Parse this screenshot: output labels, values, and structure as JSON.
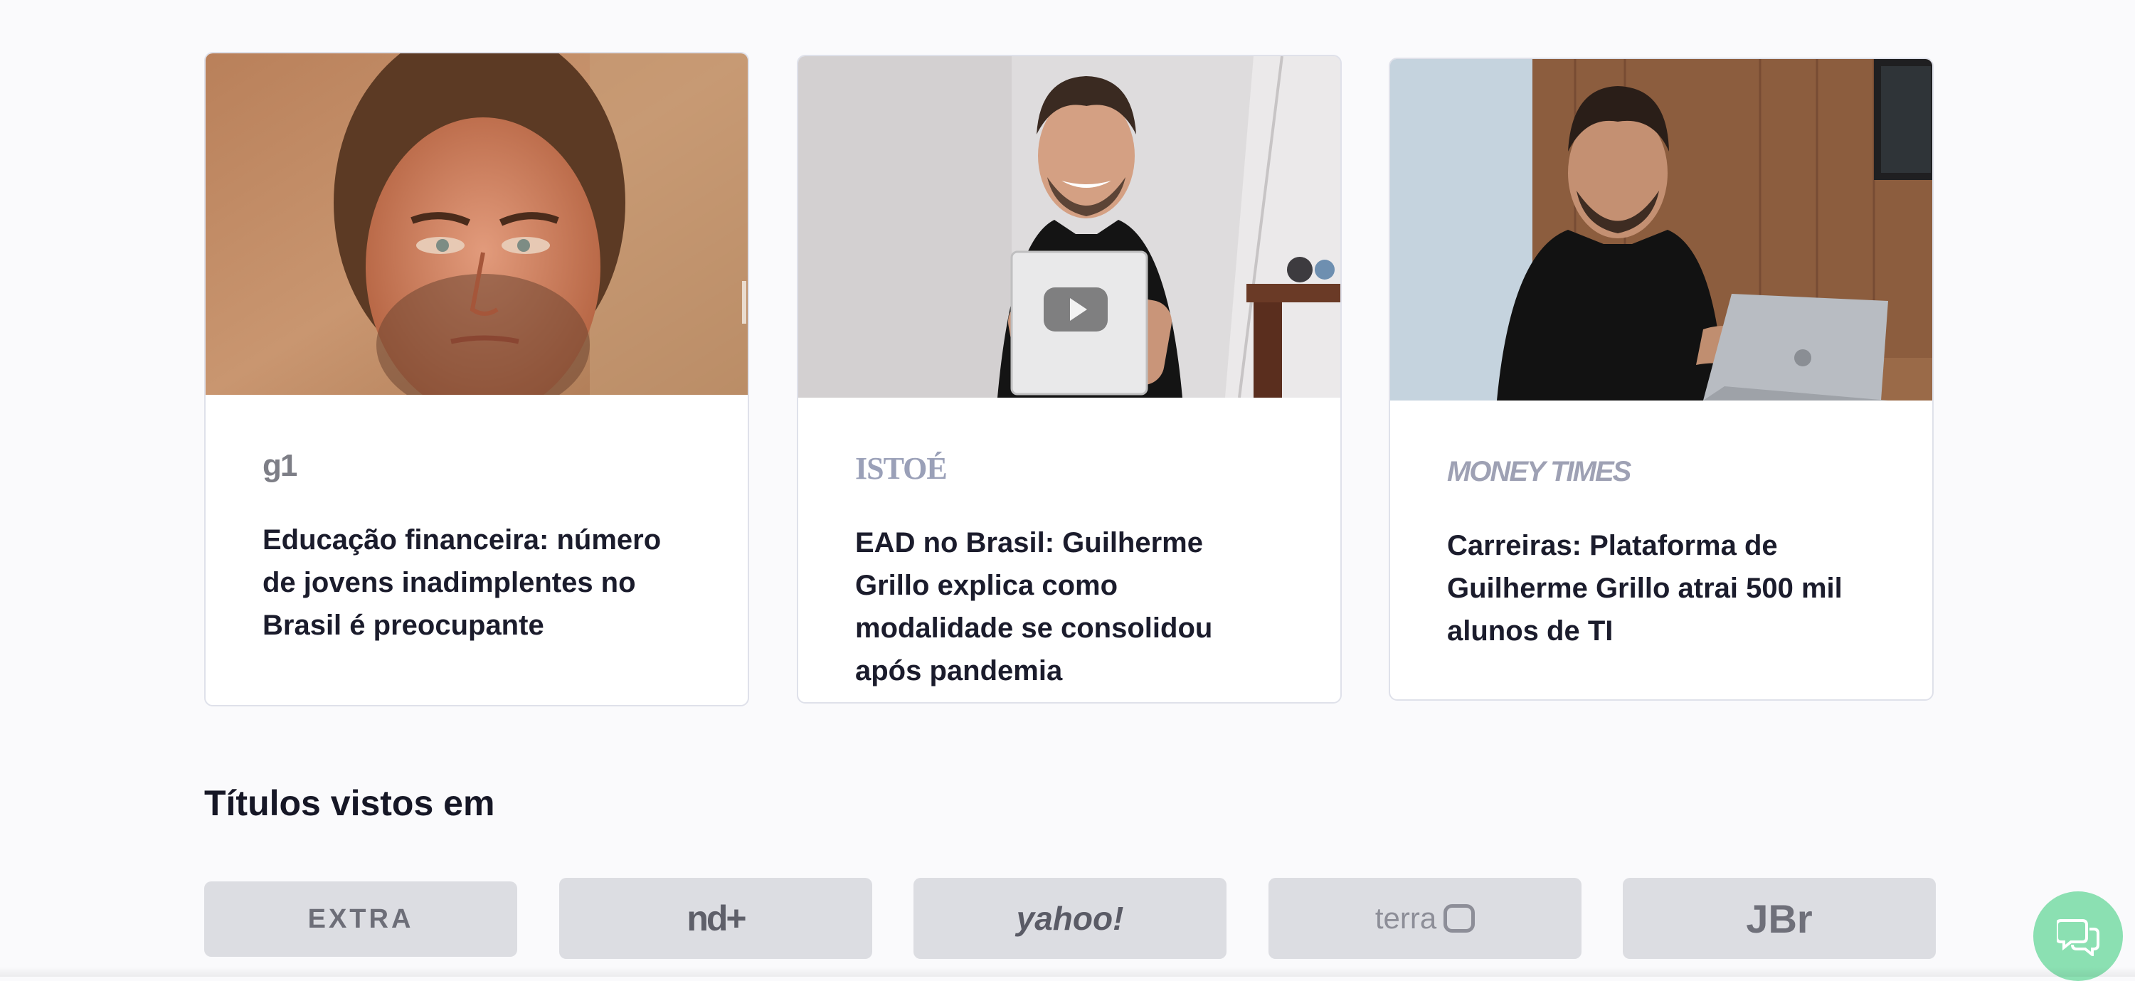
{
  "articles": [
    {
      "source": "g1",
      "headline": "Educação financeira: número de jovens inadimplentes no Brasil é preocupante",
      "photo": "man-portrait-sunset"
    },
    {
      "source": "ISTOÉ",
      "headline": "EAD no Brasil: Guilherme Grillo explica como modalidade se consolidou após pandemia",
      "photo": "man-with-youtube-plaque"
    },
    {
      "source": "MONEY TIMES",
      "headline": "Carreiras: Plataforma de Guilherme Grillo atrai 500 mil alunos de TI",
      "photo": "man-at-desk-laptop"
    }
  ],
  "seen_in": {
    "title": "Títulos vistos em",
    "logos": [
      "EXTRA",
      "nd+",
      "yahoo!",
      "terra",
      "JBr"
    ]
  },
  "chat": {
    "icon": "chat-bubbles-icon"
  },
  "colors": {
    "accent_chat": "#8be0b2",
    "headline": "#1b1c2c",
    "logo_bg": "#dcdde2"
  }
}
